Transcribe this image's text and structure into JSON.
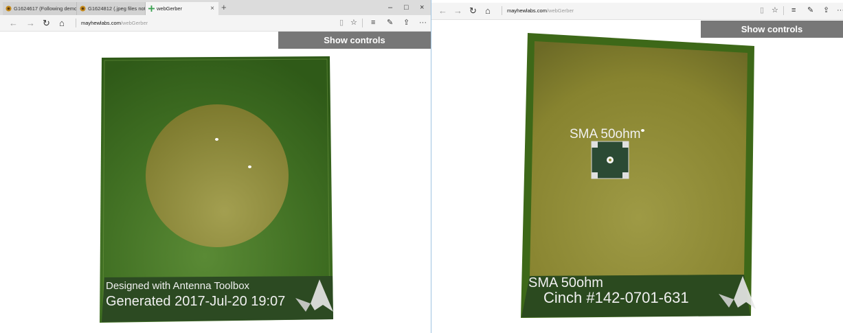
{
  "left": {
    "tabs": [
      {
        "label": "G1624617 (Following demo)",
        "state": "inactive"
      },
      {
        "label": "G1624812 (.jpeg files not su",
        "state": "inactive"
      },
      {
        "label": "webGerber",
        "state": "active",
        "close": "×"
      }
    ],
    "new_tab": "+",
    "window_controls": {
      "minimize": "–",
      "maximize": "□",
      "close": "×"
    },
    "nav": {
      "back": "←",
      "forward": "→",
      "refresh": "↻",
      "home": "⌂"
    },
    "url": {
      "host": "mayhewlabs.com",
      "path": "/webGerber"
    },
    "toolbar": {
      "reading": "▯",
      "favorite": "☆",
      "hub": "≡",
      "note": "✎",
      "share": "⇪",
      "more": "···"
    },
    "show_controls": "Show controls",
    "board": {
      "text_line1": "Designed with Antenna Toolbox",
      "text_line2": "Generated 2017-Jul-20 19:07"
    }
  },
  "right": {
    "nav": {
      "back": "←",
      "forward": "→",
      "refresh": "↻",
      "home": "⌂"
    },
    "url": {
      "host": "mayhewlabs.com",
      "path": "/webGerber"
    },
    "toolbar": {
      "reading": "▯",
      "favorite": "☆",
      "hub": "≡",
      "note": "✎",
      "share": "⇪",
      "more": "···"
    },
    "show_controls": "Show controls",
    "board": {
      "connector_label": "SMA 50ohm",
      "text_line1": "SMA 50ohm",
      "text_line2": "Cinch #142-0701-631"
    }
  },
  "colors": {
    "board_green": "#3d6b1f",
    "copper_gold": "#8e8a38",
    "silkscreen": "#f0f0f0",
    "button_gray": "#777777"
  }
}
